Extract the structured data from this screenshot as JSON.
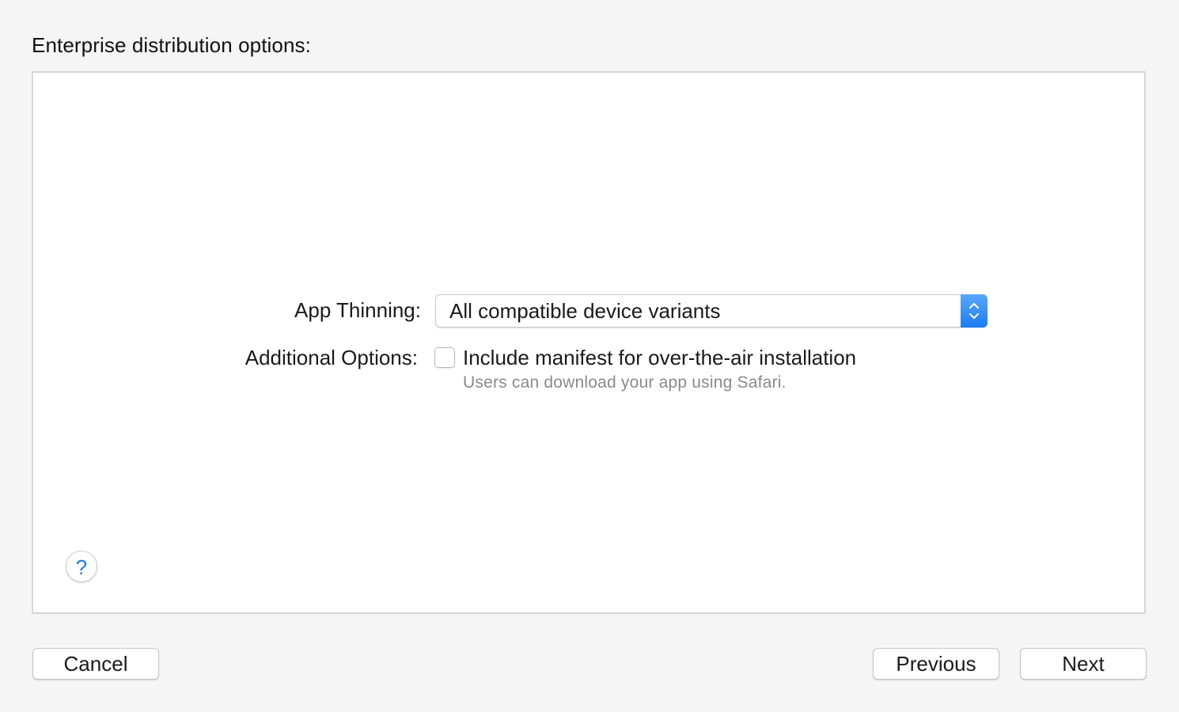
{
  "header": {
    "title": "Enterprise distribution options:"
  },
  "options": {
    "app_thinning": {
      "label": "App Thinning:",
      "selected_value": "All compatible device variants",
      "stepper_icon": "updown-chevron-icon"
    },
    "additional_options": {
      "label": "Additional Options:",
      "checkbox": {
        "checked": false,
        "label": "Include manifest for over-the-air installation",
        "description": "Users can download your app using Safari."
      }
    }
  },
  "help": {
    "glyph": "?",
    "icon": "help-icon"
  },
  "footer": {
    "cancel_label": "Cancel",
    "previous_label": "Previous",
    "next_label": "Next"
  },
  "colors": {
    "accent": "#1d7bf3",
    "help_glyph": "#1f7ae0",
    "secondary_text": "#8a8a8a"
  }
}
